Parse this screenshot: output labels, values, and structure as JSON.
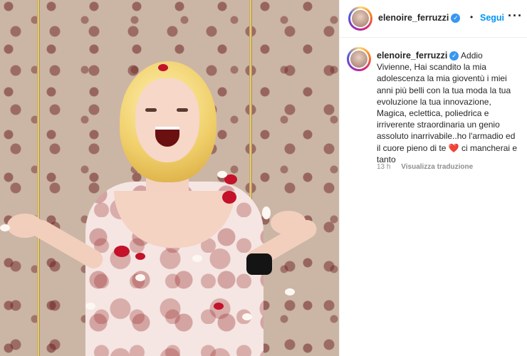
{
  "post": {
    "username": "elenoire_ferruzzi",
    "verified": true,
    "separator": "•",
    "follow_label": "Segui",
    "more_icon": "more-horizontal-icon",
    "caption_text": "Addio Vivienne, Hai scandito la mia adolescenza la mia gioventù i miei anni più belli con la tua moda la tua evoluzione la tua innovazione, Magica, eclettica, poliedrica e irriverente straordinaria un genio assoluto inarrivabile..ho l'armadio ed il cuore pieno di te ",
    "caption_emoji": "❤️",
    "caption_end": "ci mancherai e tanto",
    "timestamp": "13 h",
    "translate_label": "Visualizza traduzione"
  },
  "colors": {
    "accent": "#0095f6",
    "verified": "#3897f0",
    "meta": "#8e8e8e"
  }
}
